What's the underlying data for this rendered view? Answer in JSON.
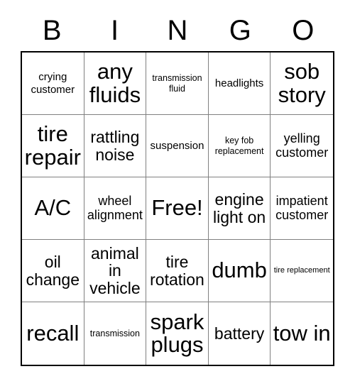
{
  "card": {
    "header": {
      "letters": [
        "B",
        "I",
        "N",
        "G",
        "O"
      ]
    },
    "cells": [
      {
        "text": "crying customer",
        "size": "sm"
      },
      {
        "text": "any fluids",
        "size": "xxl"
      },
      {
        "text": "transmission fluid",
        "size": "xs"
      },
      {
        "text": "headlights",
        "size": "sm"
      },
      {
        "text": "sob story",
        "size": "xxl"
      },
      {
        "text": "tire repair",
        "size": "xxl"
      },
      {
        "text": "rattling noise",
        "size": "lg"
      },
      {
        "text": "suspension",
        "size": "sm"
      },
      {
        "text": "key fob replacement",
        "size": "xs"
      },
      {
        "text": "yelling customer",
        "size": "md"
      },
      {
        "text": "A/C",
        "size": "xxl"
      },
      {
        "text": "wheel alignment",
        "size": "md"
      },
      {
        "text": "Free!",
        "size": "xxl"
      },
      {
        "text": "engine light on",
        "size": "lg"
      },
      {
        "text": "impatient customer",
        "size": "md"
      },
      {
        "text": "oil change",
        "size": "lg"
      },
      {
        "text": "animal in vehicle",
        "size": "lg"
      },
      {
        "text": "tire rotation",
        "size": "lg"
      },
      {
        "text": "dumb",
        "size": "xxl"
      },
      {
        "text": "tire replacement",
        "size": "xxs"
      },
      {
        "text": "recall",
        "size": "xxl"
      },
      {
        "text": "transmission",
        "size": "xs"
      },
      {
        "text": "spark plugs",
        "size": "xxl"
      },
      {
        "text": "battery",
        "size": "lg"
      },
      {
        "text": "tow in",
        "size": "xxl"
      }
    ],
    "colors": {
      "background": "#ffffff",
      "text": "#000000",
      "outer_border": "#000000",
      "inner_border": "#808080"
    }
  }
}
